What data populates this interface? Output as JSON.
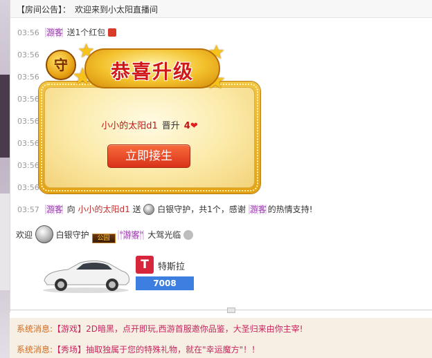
{
  "announcement": {
    "label": "【房间公告】：",
    "text": "欢迎来到小太阳直播间"
  },
  "chat": {
    "rows": [
      {
        "time": "03:56",
        "user": "游客",
        "text": "送1个红包"
      },
      {
        "time": "03:56"
      },
      {
        "time": "03:56"
      },
      {
        "time": "03:56"
      },
      {
        "time": "03:56"
      },
      {
        "time": "03:56"
      },
      {
        "time": "03:56"
      },
      {
        "time": "03:56"
      }
    ],
    "gift_row": {
      "time": "03:57",
      "sender": "游客",
      "to": "向",
      "target": "小小的太阳d1",
      "send": "送",
      "gift": "白银守护",
      "count": "，共1个，感谢",
      "thanker": "游客",
      "thanks": "的热情支持!"
    },
    "welcome_row": {
      "welcome": "欢迎",
      "guard": "白银守护",
      "medal": "公园",
      "user": "\"游客\"",
      "enter": "大驾光临"
    }
  },
  "popup": {
    "title": "恭喜升级",
    "badge": "守",
    "user": "小小的太阳d1",
    "verb": "晋升",
    "level": "4",
    "button": "立即接生"
  },
  "car_gift": {
    "brand_logo": "T",
    "name": "特斯拉",
    "count": "7008"
  },
  "system_messages": [
    {
      "tag": "系统消息:",
      "category": "【游戏】",
      "text": "2D暗黑，点开即玩,西游首服邀你品鉴，大圣归来由你主宰!"
    },
    {
      "tag": "系统消息:",
      "category": "【秀场】",
      "text": "抽取独属于您的特殊礼物，就在\"幸运魔方\"！！"
    }
  ],
  "colors": {
    "accent_red": "#d01818",
    "user_purple": "#a23db4",
    "system_orange": "#d2691e",
    "system_magenta": "#c5265e",
    "count_blue": "#3d7fe0"
  }
}
